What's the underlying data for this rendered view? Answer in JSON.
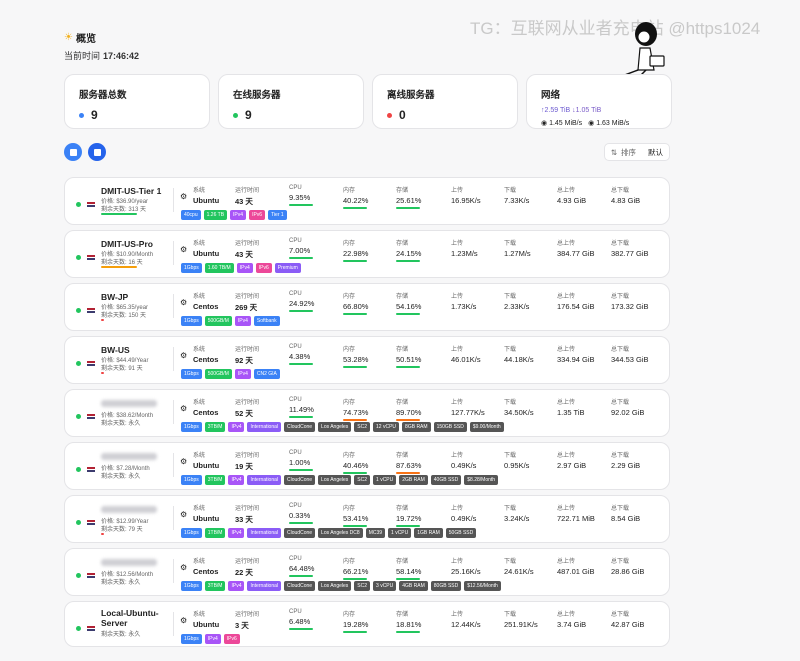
{
  "watermark": "TG：互联网从业者充电站 @https1024",
  "header": {
    "title": "概览",
    "time_label": "当前时间",
    "time_value": "17:46:42"
  },
  "stats": {
    "total": {
      "label": "服务器总数",
      "value": "9",
      "color": "#3b82f6"
    },
    "online": {
      "label": "在线服务器",
      "value": "9",
      "color": "#22c55e"
    },
    "offline": {
      "label": "离线服务器",
      "value": "0",
      "color": "#ef4444"
    },
    "network": {
      "label": "网络",
      "up": "↑2.59 TiB",
      "down": "↓1.05 TiB",
      "up_speed": "1.45 MiB/s",
      "down_speed": "1.63 MiB/s"
    }
  },
  "toolbar": {
    "sort_label": "排序",
    "sort_value": "默认",
    "view_btn1_color": "#3b82f6",
    "view_btn2_color": "#2563eb"
  },
  "labels": {
    "os": "系统",
    "uptime": "运行时间",
    "cpu": "CPU",
    "mem": "内存",
    "disk": "存储",
    "upload": "上传",
    "download": "下载",
    "total_up": "总上传",
    "total_down": "总下载"
  },
  "servers": [
    {
      "name": "DMIT-US-Tier 1",
      "price": "价格: $36.90/year",
      "remain": "剩余天数: 313 天",
      "os": "Ubuntu",
      "uptime": "43 天",
      "cpu": "9.35%",
      "mem": "40.22%",
      "disk": "25.61%",
      "up": "16.95K/s",
      "down": "7.33K/s",
      "total_up": "4.93 GiB",
      "total_down": "4.83 GiB",
      "bar_color": "#22c55e",
      "tags": [
        {
          "t": "40cpu",
          "c": "#3b82f6"
        },
        {
          "t": "1.26 TB",
          "c": "#22c55e"
        },
        {
          "t": "IPv4",
          "c": "#a855f7"
        },
        {
          "t": "IPv6",
          "c": "#ec4899"
        },
        {
          "t": "Tier 1",
          "c": "#3b82f6"
        }
      ]
    },
    {
      "name": "DMIT-US-Pro",
      "price": "价格: $10.90/Month",
      "remain": "剩余天数: 16 天",
      "os": "Ubuntu",
      "uptime": "43 天",
      "cpu": "7.00%",
      "mem": "22.98%",
      "disk": "24.15%",
      "up": "1.23M/s",
      "down": "1.27M/s",
      "total_up": "384.77 GiB",
      "total_down": "382.77 GiB",
      "bar_color": "#f59e0b",
      "tags": [
        {
          "t": "1Gbps",
          "c": "#3b82f6"
        },
        {
          "t": "1.60 TB/M",
          "c": "#22c55e"
        },
        {
          "t": "IPv4",
          "c": "#a855f7"
        },
        {
          "t": "IPv6",
          "c": "#ec4899"
        },
        {
          "t": "Premium",
          "c": "#8b5cf6"
        }
      ]
    },
    {
      "name": "BW-JP",
      "price": "价格: $65.35/year",
      "remain": "剩余天数: 150 天",
      "os": "Centos",
      "uptime": "269 天",
      "cpu": "24.92%",
      "mem": "66.80%",
      "disk": "54.16%",
      "up": "1.73K/s",
      "down": "2.33K/s",
      "total_up": "176.54 GiB",
      "total_down": "173.32 GiB",
      "bar_color": "#ef4444",
      "tags": [
        {
          "t": "1Gbps",
          "c": "#3b82f6"
        },
        {
          "t": "500GB/M",
          "c": "#22c55e"
        },
        {
          "t": "IPv4",
          "c": "#a855f7"
        },
        {
          "t": "Softbank",
          "c": "#3b82f6"
        }
      ]
    },
    {
      "name": "BW-US",
      "price": "价格: $44.49/Year",
      "remain": "剩余天数: 91 天",
      "os": "Centos",
      "uptime": "92 天",
      "cpu": "4.38%",
      "mem": "53.28%",
      "disk": "50.51%",
      "up": "46.01K/s",
      "down": "44.18K/s",
      "total_up": "334.94 GiB",
      "total_down": "344.53 GiB",
      "bar_color": "#ef4444",
      "tags": [
        {
          "t": "1Gbps",
          "c": "#3b82f6"
        },
        {
          "t": "500GB/M",
          "c": "#22c55e"
        },
        {
          "t": "IPv4",
          "c": "#a855f7"
        },
        {
          "t": "CN2 GIA",
          "c": "#3b82f6"
        }
      ]
    },
    {
      "name": "",
      "price": "价格: $38.62/Month",
      "remain": "剩余天数: 永久",
      "os": "Centos",
      "uptime": "52 天",
      "cpu": "11.49%",
      "mem": "74.73%",
      "disk": "89.70%",
      "up": "127.77K/s",
      "down": "34.50K/s",
      "total_up": "1.35 TiB",
      "total_down": "92.02 GiB",
      "bar_color": "",
      "tags": [
        {
          "t": "1Gbps",
          "c": "#3b82f6"
        },
        {
          "t": "3TB/M",
          "c": "#22c55e"
        },
        {
          "t": "IPv4",
          "c": "#a855f7"
        },
        {
          "t": "International",
          "c": "#8b5cf6"
        },
        {
          "t": "CloudCone",
          "c": "#555"
        },
        {
          "t": "Los Angeles",
          "c": "#555"
        },
        {
          "t": "SC2",
          "c": "#555"
        },
        {
          "t": "12 vCPU",
          "c": "#555"
        },
        {
          "t": "8GB RAM",
          "c": "#555"
        },
        {
          "t": "150GB SSD",
          "c": "#555"
        },
        {
          "t": "$9.00/Month",
          "c": "#555"
        }
      ]
    },
    {
      "name": "",
      "price": "价格: $7.28/Month",
      "remain": "剩余天数: 永久",
      "os": "Ubuntu",
      "uptime": "19 天",
      "cpu": "1.00%",
      "mem": "40.46%",
      "disk": "87.63%",
      "up": "0.49K/s",
      "down": "0.95K/s",
      "total_up": "2.97 GiB",
      "total_down": "2.29 GiB",
      "bar_color": "",
      "tags": [
        {
          "t": "1Gbps",
          "c": "#3b82f6"
        },
        {
          "t": "3TB/M",
          "c": "#22c55e"
        },
        {
          "t": "IPv4",
          "c": "#a855f7"
        },
        {
          "t": "International",
          "c": "#8b5cf6"
        },
        {
          "t": "CloudCone",
          "c": "#555"
        },
        {
          "t": "Los Angeles",
          "c": "#555"
        },
        {
          "t": "SC2",
          "c": "#555"
        },
        {
          "t": "1 vCPU",
          "c": "#555"
        },
        {
          "t": "2GB RAM",
          "c": "#555"
        },
        {
          "t": "40GB SSD",
          "c": "#555"
        },
        {
          "t": "$8.28/Month",
          "c": "#555"
        }
      ]
    },
    {
      "name": "",
      "price": "价格: $12.99/Year",
      "remain": "剩余天数: 79 天",
      "os": "Ubuntu",
      "uptime": "33 天",
      "cpu": "0.33%",
      "mem": "53.41%",
      "disk": "19.72%",
      "up": "0.49K/s",
      "down": "3.24K/s",
      "total_up": "722.71 MiB",
      "total_down": "8.54 GiB",
      "bar_color": "#ef4444",
      "tags": [
        {
          "t": "1Gbps",
          "c": "#3b82f6"
        },
        {
          "t": "1TB/M",
          "c": "#22c55e"
        },
        {
          "t": "IPv4",
          "c": "#a855f7"
        },
        {
          "t": "International",
          "c": "#8b5cf6"
        },
        {
          "t": "CloudCone",
          "c": "#555"
        },
        {
          "t": "Los Angeles DC8",
          "c": "#555"
        },
        {
          "t": "MC39",
          "c": "#555"
        },
        {
          "t": "1 vCPU",
          "c": "#555"
        },
        {
          "t": "1GB RAM",
          "c": "#555"
        },
        {
          "t": "50GB SSD",
          "c": "#555"
        }
      ]
    },
    {
      "name": "",
      "price": "价格: $12.56/Month",
      "remain": "剩余天数: 永久",
      "os": "Centos",
      "uptime": "22 天",
      "cpu": "64.48%",
      "mem": "66.21%",
      "disk": "58.14%",
      "up": "25.16K/s",
      "down": "24.61K/s",
      "total_up": "487.01 GiB",
      "total_down": "28.86 GiB",
      "bar_color": "",
      "tags": [
        {
          "t": "1Gbps",
          "c": "#3b82f6"
        },
        {
          "t": "3TB/M",
          "c": "#22c55e"
        },
        {
          "t": "IPv4",
          "c": "#a855f7"
        },
        {
          "t": "International",
          "c": "#8b5cf6"
        },
        {
          "t": "CloudCone",
          "c": "#555"
        },
        {
          "t": "Los Angeles",
          "c": "#555"
        },
        {
          "t": "SC2",
          "c": "#555"
        },
        {
          "t": "3 vCPU",
          "c": "#555"
        },
        {
          "t": "4GB RAM",
          "c": "#555"
        },
        {
          "t": "80GB SSD",
          "c": "#555"
        },
        {
          "t": "$12.56/Month",
          "c": "#555"
        }
      ]
    },
    {
      "name": "Local-Ubuntu-Server",
      "price": "",
      "remain": "剩余天数: 永久",
      "os": "Ubuntu",
      "uptime": "3 天",
      "cpu": "6.48%",
      "mem": "19.28%",
      "disk": "18.81%",
      "up": "12.44K/s",
      "down": "251.91K/s",
      "total_up": "3.74 GiB",
      "total_down": "42.87 GiB",
      "bar_color": "",
      "tags": [
        {
          "t": "1Gbps",
          "c": "#3b82f6"
        },
        {
          "t": "IPv4",
          "c": "#a855f7"
        },
        {
          "t": "IPv6",
          "c": "#ec4899"
        }
      ]
    }
  ]
}
